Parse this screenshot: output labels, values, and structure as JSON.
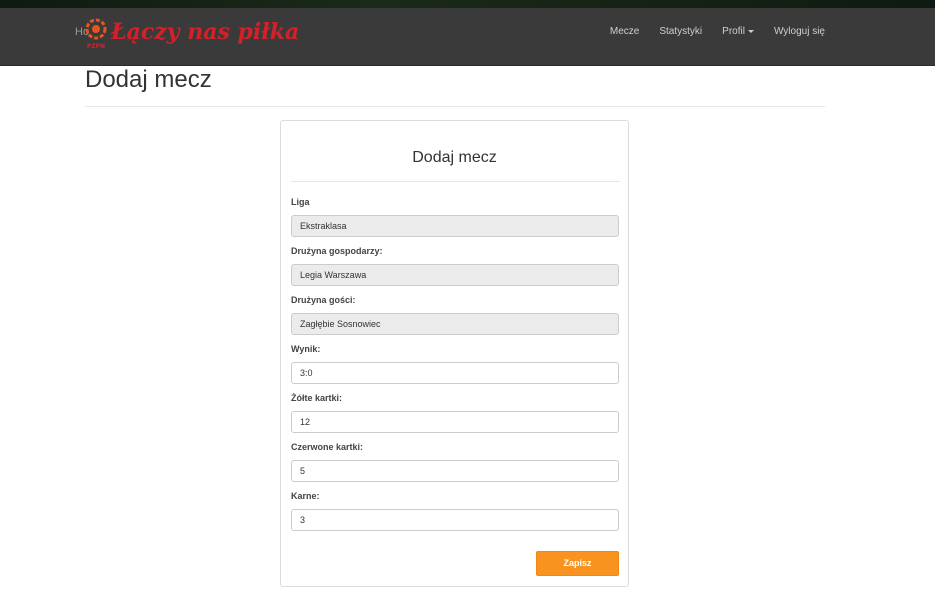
{
  "navbar": {
    "home_text": "Ho",
    "brand_text": "Łączy nas piłka",
    "emblem_text": "PZPN",
    "links": [
      {
        "label": "Mecze"
      },
      {
        "label": "Statystyki"
      },
      {
        "label": "Profil"
      },
      {
        "label": "Wyloguj się"
      }
    ]
  },
  "page": {
    "title": "Dodaj mecz"
  },
  "form": {
    "title": "Dodaj mecz",
    "fields": [
      {
        "label": "Liga",
        "value": "Ekstraklasa",
        "disabled": true
      },
      {
        "label": "Drużyna gospodarzy:",
        "value": "Legia Warszawa",
        "disabled": true
      },
      {
        "label": "Drużyna gości:",
        "value": "Zagłębie Sosnowiec",
        "disabled": true
      },
      {
        "label": "Wynik:",
        "value": "3:0",
        "disabled": false
      },
      {
        "label": "Żółte kartki:",
        "value": "12",
        "disabled": false
      },
      {
        "label": "Czerwone kartki:",
        "value": "5",
        "disabled": false
      },
      {
        "label": "Karne:",
        "value": "3",
        "disabled": false
      }
    ],
    "submit_label": "Zapisz"
  },
  "colors": {
    "navbar": "#3a3a3a",
    "brand": "#d5202a",
    "submit": "#f7931e"
  }
}
